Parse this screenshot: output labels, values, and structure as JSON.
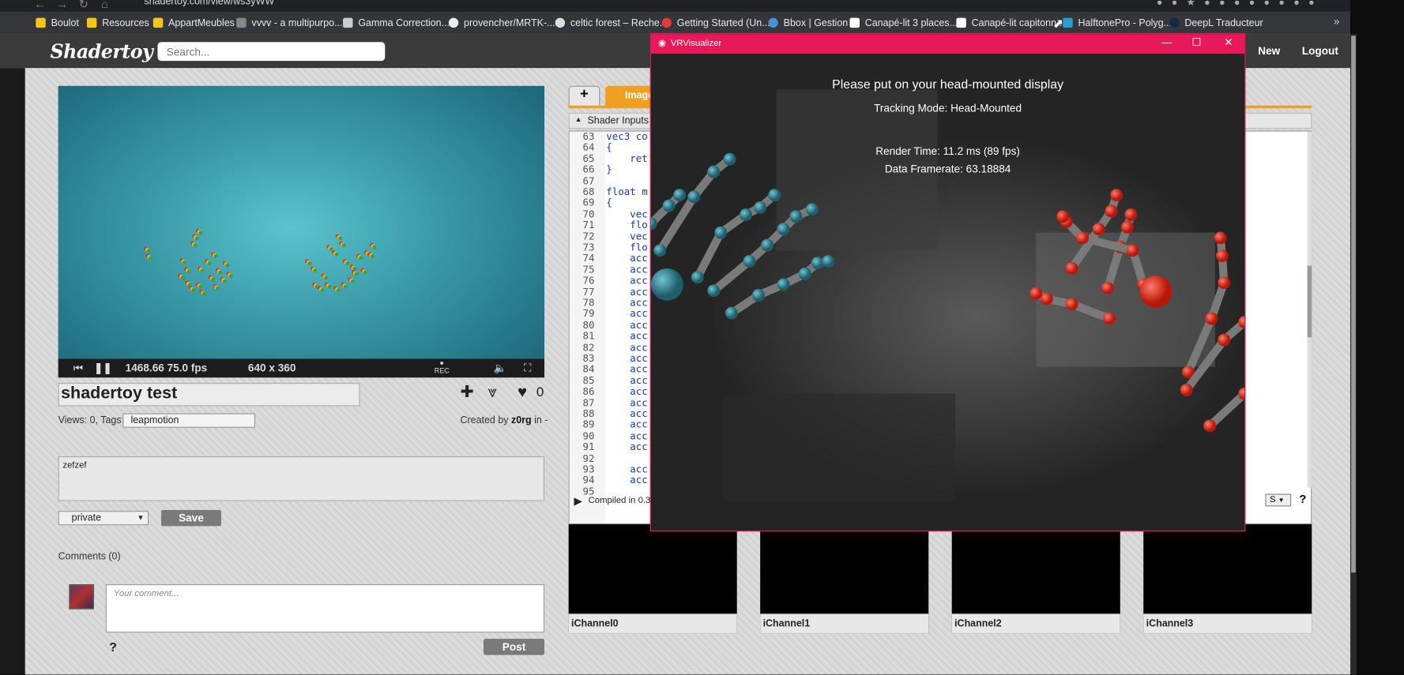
{
  "browser": {
    "url": "shadertoy.com/view/ws3yWW",
    "bookmarks": [
      {
        "label": "Boulot",
        "color": "#f5c518"
      },
      {
        "label": "Resources",
        "color": "#f5c518"
      },
      {
        "label": "AppartMeubles",
        "color": "#f5c518"
      },
      {
        "label": "vvvv - a multipurpo...",
        "color": "#888888"
      },
      {
        "label": "Gamma Correction...",
        "color": "#cccccc"
      },
      {
        "label": "provencher/MRTK-...",
        "color": "#eeeeee"
      },
      {
        "label": "celtic forest – Reche...",
        "color": "#dddddd"
      },
      {
        "label": "Getting Started (Un...",
        "color": "#e53935"
      },
      {
        "label": "Bbox | Gestion",
        "color": "#4a8fd0"
      },
      {
        "label": "Canapé-lit 3 places...",
        "color": "#ffffff"
      },
      {
        "label": "Canapé-lit capitonn...",
        "color": "#ffffff"
      },
      {
        "label": "HalftonePro - Polyg...",
        "color": "#2aa0c8"
      },
      {
        "label": "DeepL Traducteur",
        "color": "#0f2b46"
      }
    ],
    "more": "»"
  },
  "shadertoy": {
    "logo": "Shadertoy",
    "search_placeholder": "Search...",
    "nav_new": "New",
    "nav_logout": "Logout"
  },
  "player": {
    "time_fps": "1468.66 75.0 fps",
    "resolution": "640 x 360",
    "rec_label": "REC"
  },
  "shader": {
    "title": "shadertoy test",
    "likes": "0",
    "views_tags": "Views: 0, Tags:",
    "tags": "leapmotion",
    "created_prefix": "Created by",
    "author": "z0rg",
    "created_suffix": "in -",
    "description": "zefzef",
    "privacy": "private",
    "save": "Save"
  },
  "comments": {
    "header": "Comments (0)",
    "placeholder": "Your comment...",
    "help": "?",
    "post": "Post"
  },
  "editor": {
    "add_tab": "+",
    "tab_image": "Image",
    "shader_inputs": "Shader Inputs",
    "compiled": "Compiled in 0.3",
    "sound_select": "S",
    "help": "?",
    "lines": [
      {
        "n": "63",
        "t": "vec3 co"
      },
      {
        "n": "64",
        "t": "{"
      },
      {
        "n": "65",
        "t": "    ret"
      },
      {
        "n": "66",
        "t": "}"
      },
      {
        "n": "67",
        "t": ""
      },
      {
        "n": "68",
        "t": "float m"
      },
      {
        "n": "69",
        "t": "{"
      },
      {
        "n": "70",
        "t": "    vec"
      },
      {
        "n": "71",
        "t": "    flo"
      },
      {
        "n": "72",
        "t": "    vec"
      },
      {
        "n": "73",
        "t": "    flo"
      },
      {
        "n": "74",
        "t": "    acc"
      },
      {
        "n": "75",
        "t": "    acc"
      },
      {
        "n": "76",
        "t": "    acc"
      },
      {
        "n": "77",
        "t": "    acc"
      },
      {
        "n": "78",
        "t": "    acc"
      },
      {
        "n": "79",
        "t": "    acc"
      },
      {
        "n": "80",
        "t": "    acc"
      },
      {
        "n": "81",
        "t": "    acc"
      },
      {
        "n": "82",
        "t": "    acc"
      },
      {
        "n": "83",
        "t": "    acc"
      },
      {
        "n": "84",
        "t": "    acc"
      },
      {
        "n": "85",
        "t": "    acc"
      },
      {
        "n": "86",
        "t": "    acc"
      },
      {
        "n": "87",
        "t": "    acc"
      },
      {
        "n": "88",
        "t": "    acc"
      },
      {
        "n": "89",
        "t": "    acc"
      },
      {
        "n": "90",
        "t": "    acc"
      },
      {
        "n": "91",
        "t": "    acc"
      },
      {
        "n": "92",
        "t": ""
      },
      {
        "n": "93",
        "t": "    acc"
      },
      {
        "n": "94",
        "t": "    acc"
      },
      {
        "n": "95",
        "t": ""
      }
    ],
    "channels": [
      "iChannel0",
      "iChannel1",
      "iChannel2",
      "iChannel3"
    ]
  },
  "vr": {
    "title": "VRVisualizer",
    "line1": "Please put on your head-mounted display",
    "line2": "Tracking Mode: Head-Mounted",
    "line3": "Render Time: 11.2 ms (89 fps)",
    "line4": "Data Framerate: 63.18884",
    "left_hand_color": "#2a7a8a",
    "right_hand_color": "#e8281a"
  }
}
